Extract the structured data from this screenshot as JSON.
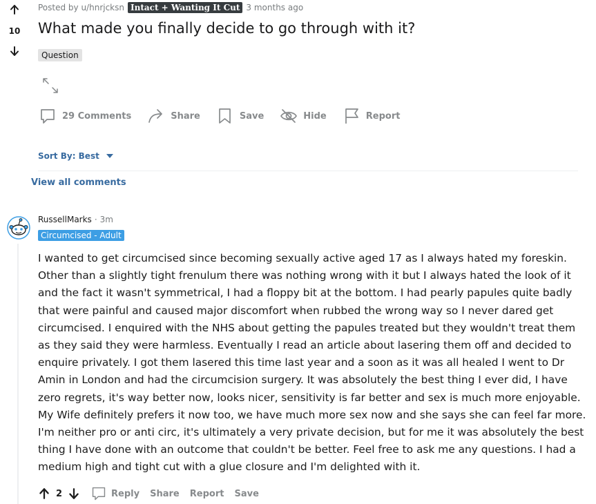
{
  "post": {
    "score": "10",
    "posted_by": "Posted by u/hnrjcksn",
    "user_flair": "Intact + Wanting It Cut",
    "age": "3 months ago",
    "title": "What made you finally decide to go through with it?",
    "tag": "Question",
    "actions": {
      "comments": "29 Comments",
      "share": "Share",
      "save": "Save",
      "hide": "Hide",
      "report": "Report"
    }
  },
  "sort": {
    "label": "Sort By: Best"
  },
  "view_all": "View all comments",
  "comment": {
    "author": "RussellMarks",
    "separator": "·",
    "age": "3m",
    "flair": "Circumcised - Adult",
    "body": "I wanted to get circumcised since becoming sexually active aged 17 as I always hated my foreskin. Other than a slightly tight frenulum there was nothing wrong with it but I always hated the look of it and the fact it wasn't symmetrical, I had a floppy bit at the bottom. I had pearly papules quite badly that were painful and caused major discomfort when rubbed the wrong way so I never dared get circumcised. I enquired with the NHS about getting the papules treated but they wouldn't treat them as they said they were harmless. Eventually I read an article about lasering them off and decided to enquire privately. I got them lasered this time last year and a soon as it was all healed I went to Dr Amin in London and had the circumcision surgery. It was absolutely the best thing I ever did, I have zero regrets, it's way better now, looks nicer, sensitivity is far better and sex is much more enjoyable. My Wife definitely prefers it now too, we have much more sex now and she says she can feel far more. I'm neither pro or anti circ, it's ultimately a very private decision, but for me it was absolutely the best thing I have done with an outcome that couldn't be better. Feel free to ask me any questions. I had a medium high and tight cut with a glue closure and I'm delighted with it.",
    "score": "2",
    "actions": {
      "reply": "Reply",
      "share": "Share",
      "report": "Report",
      "save": "Save"
    }
  },
  "icons": {
    "upvote": "arrow-up-icon",
    "downvote": "arrow-down-icon",
    "expand": "expand-icon",
    "comments": "comment-bubble-icon",
    "share": "share-arrow-icon",
    "save": "bookmark-icon",
    "hide": "eye-slash-icon",
    "report": "flag-icon",
    "sort_caret": "caret-down-icon",
    "avatar": "snoo-avatar-icon"
  },
  "colors": {
    "link_blue": "#386ba0",
    "flair_dark": "#373c3f",
    "flair_blue": "#3d9ee4",
    "muted": "#878a8c"
  }
}
